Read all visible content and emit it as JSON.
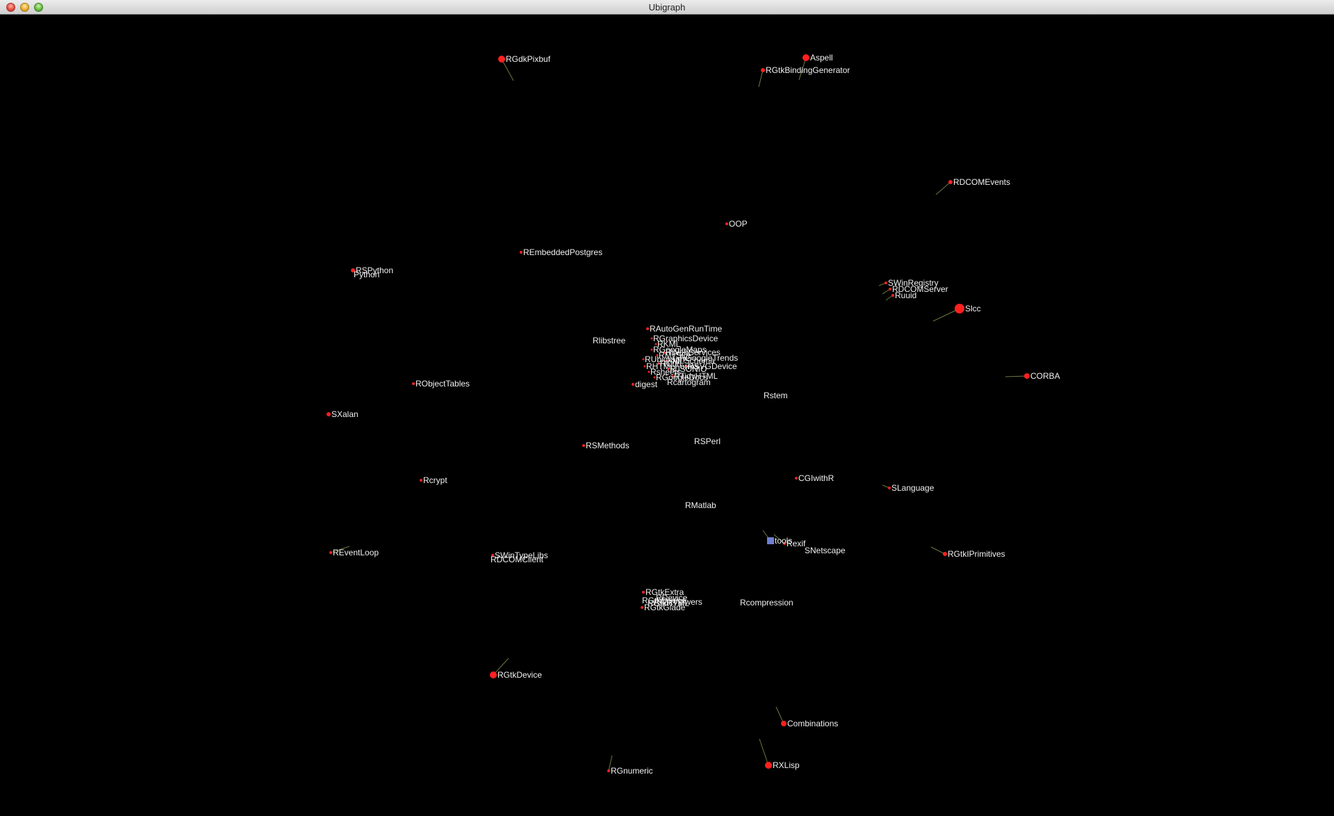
{
  "window": {
    "title": "Ubigraph"
  },
  "graph": {
    "node_color": "#ff2020",
    "edge_color": "#6a7a40",
    "label_color": "#f0f0f0",
    "special_node_color": "#6f7fd0",
    "nodes": [
      {
        "id": "RGdkPixbuf",
        "label": "RGdkPixbuf"
      },
      {
        "id": "Aspell",
        "label": "Aspell"
      },
      {
        "id": "RGtkBindingGenerator",
        "label": "RGtkBindingGenerator"
      },
      {
        "id": "RDCOMEvents",
        "label": "RDCOMEvents"
      },
      {
        "id": "OOP",
        "label": "OOP"
      },
      {
        "id": "REmbeddedPostgres",
        "label": "REmbeddedPostgres"
      },
      {
        "id": "RSPython",
        "label": "RSPython"
      },
      {
        "id": "Python",
        "label": "Python"
      },
      {
        "id": "SWinRegistry",
        "label": "SWinRegistry"
      },
      {
        "id": "RDCOMServer",
        "label": "RDCOMServer"
      },
      {
        "id": "Ruuid",
        "label": "Ruuid"
      },
      {
        "id": "Slcc",
        "label": "Slcc"
      },
      {
        "id": "RAutoGenRunTime",
        "label": "RAutoGenRunTime"
      },
      {
        "id": "Rlibstree",
        "label": "Rlibstree"
      },
      {
        "id": "RGraphicsDevice",
        "label": "RGraphicsDevice"
      },
      {
        "id": "RObjectTables",
        "label": "RObjectTables"
      },
      {
        "id": "CORBA",
        "label": "CORBA"
      },
      {
        "id": "digest",
        "label": "digest"
      },
      {
        "id": "Rcartogram",
        "label": "Rcartogram"
      },
      {
        "id": "Rstem",
        "label": "Rstem"
      },
      {
        "id": "SXalan",
        "label": "SXalan"
      },
      {
        "id": "RSMethods",
        "label": "RSMethods"
      },
      {
        "id": "RSPerl",
        "label": "RSPerl"
      },
      {
        "id": "CGIwithR",
        "label": "CGIwithR"
      },
      {
        "id": "Rcrypt",
        "label": "Rcrypt"
      },
      {
        "id": "SLanguage",
        "label": "SLanguage"
      },
      {
        "id": "RMatlab",
        "label": "RMatlab"
      },
      {
        "id": "tools",
        "label": "tools"
      },
      {
        "id": "Rexif",
        "label": "Rexif"
      },
      {
        "id": "SNetscape",
        "label": "SNetscape"
      },
      {
        "id": "REventLoop",
        "label": "REventLoop"
      },
      {
        "id": "SWinTypeLibs",
        "label": "SWinTypeLibs"
      },
      {
        "id": "RDCOMClient",
        "label": "RDCOMClient"
      },
      {
        "id": "RGtkIPrimitives",
        "label": "RGtkIPrimitives"
      },
      {
        "id": "RGtkExtra",
        "label": "RGtkExtra"
      },
      {
        "id": "RGtkViewers",
        "label": "RGtkViewers"
      },
      {
        "id": "RGtkGlade",
        "label": "RGtkGlade"
      },
      {
        "id": "Rcompression",
        "label": "Rcompression"
      },
      {
        "id": "RGtkDevice",
        "label": "RGtkDevice"
      },
      {
        "id": "Combinations",
        "label": "Combinations"
      },
      {
        "id": "RXLisp",
        "label": "RXLisp"
      },
      {
        "id": "RGnumeric",
        "label": "RGnumeric"
      }
    ],
    "cluster_labels": [
      "RGraphicsDevice",
      "RKML",
      "RGoogleMaps",
      "RMySQL",
      "XMLSchema",
      "RHTMLForms",
      "Rsheets",
      "RGoogleDocs",
      "RUbigraph",
      "RCurl",
      "RJSONIO",
      "RGoogleTrends",
      "RSVGDevice",
      "RTidyHTML",
      "RWebServices"
    ],
    "cluster_extra_labels": [
      "RGtkDevice",
      "RGtkHTML",
      "RDevice"
    ]
  }
}
